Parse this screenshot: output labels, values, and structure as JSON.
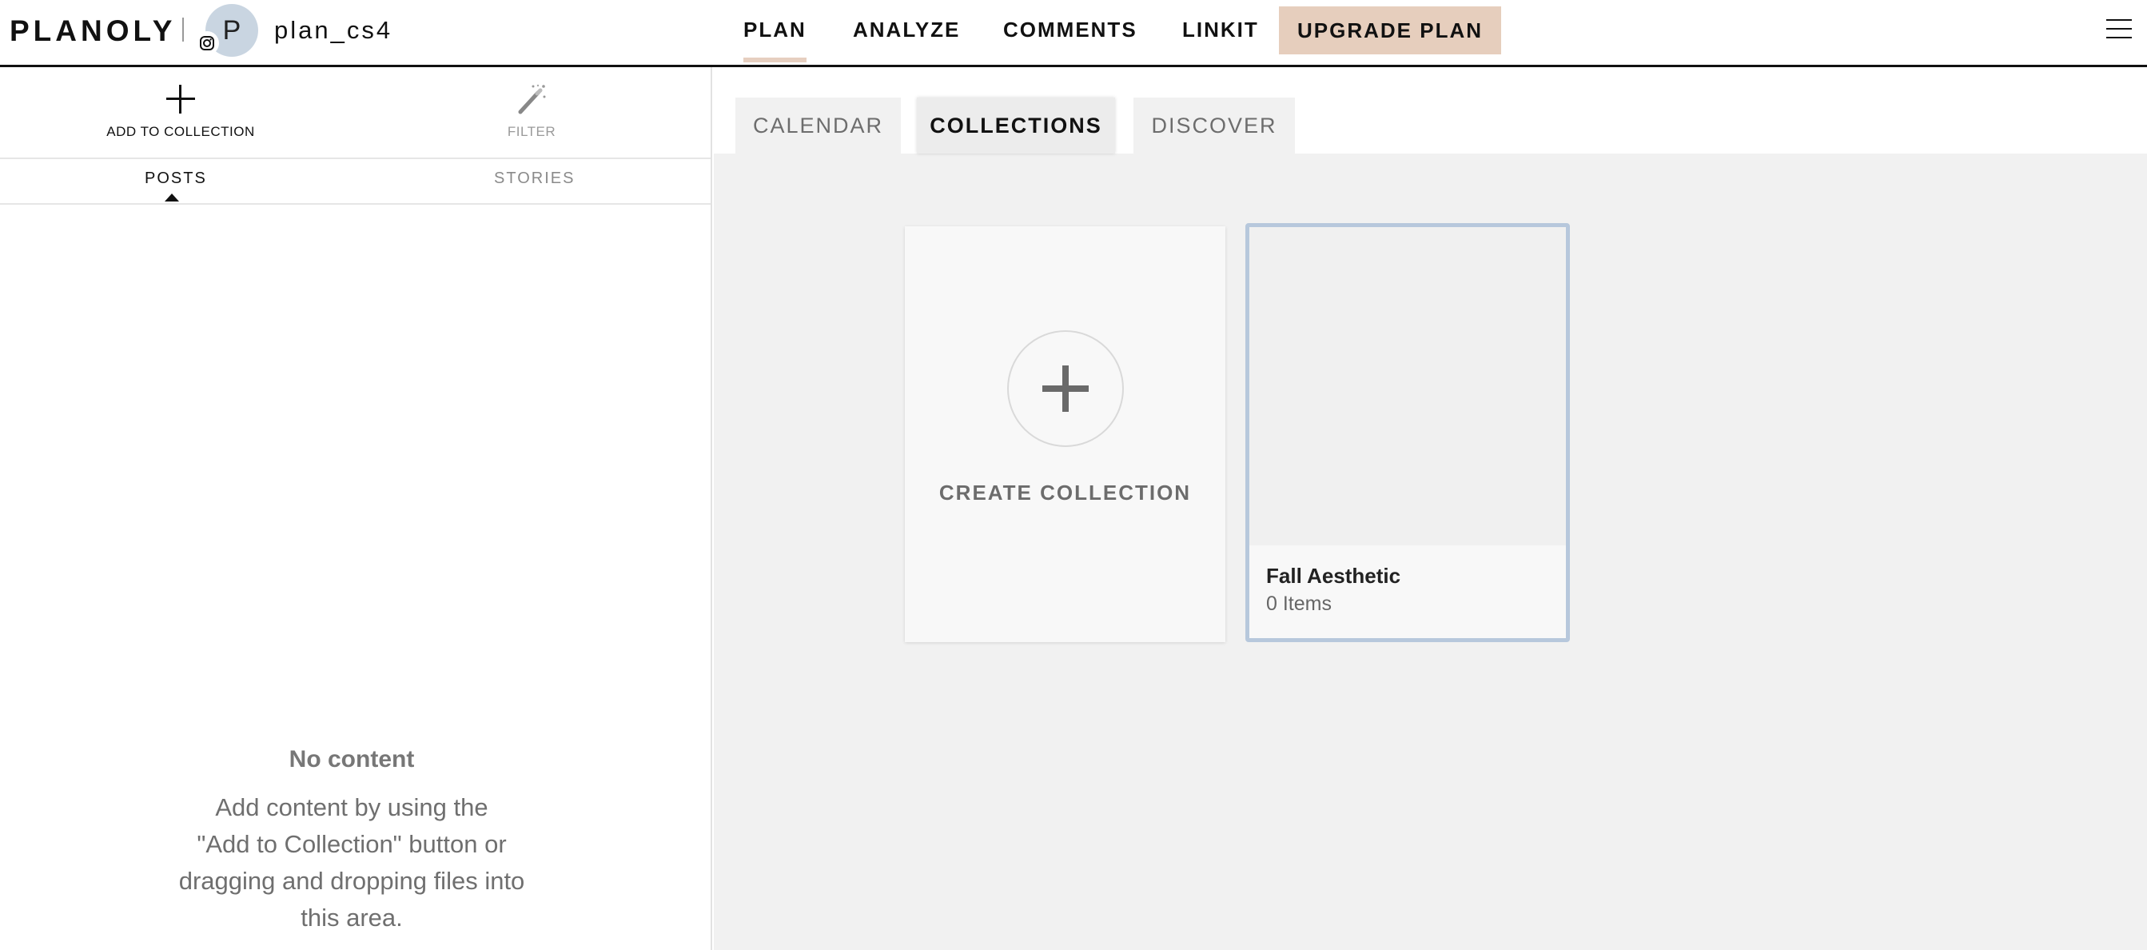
{
  "header": {
    "logo": "PLANOLY",
    "avatar_initial": "P",
    "account_name": "plan_cs4",
    "nav": [
      {
        "label": "PLAN",
        "active": true
      },
      {
        "label": "ANALYZE",
        "active": false
      },
      {
        "label": "COMMENTS",
        "active": false
      },
      {
        "label": "LINKIT",
        "active": false
      }
    ],
    "upgrade_label": "UPGRADE PLAN",
    "icons": {
      "account_badge": "instagram-icon",
      "menu": "hamburger-menu-icon"
    }
  },
  "left_panel": {
    "tools": {
      "add_label": "ADD TO COLLECTION",
      "add_icon": "plus-icon",
      "filter_label": "FILTER",
      "filter_icon": "magic-wand-icon"
    },
    "subtabs": {
      "posts": "POSTS",
      "stories": "STORIES",
      "active": "POSTS"
    },
    "empty_state": {
      "title": "No content",
      "line1": "Add content by using the",
      "line2": "\"Add to Collection\" button or",
      "line3": "dragging and dropping files into",
      "line4": "this area."
    }
  },
  "right_panel": {
    "tabs": [
      {
        "label": "CALENDAR",
        "active": false
      },
      {
        "label": "COLLECTIONS",
        "active": true
      },
      {
        "label": "DISCOVER",
        "active": false
      }
    ],
    "create_card": {
      "label": "CREATE COLLECTION",
      "icon": "plus-circle-icon"
    },
    "collections": [
      {
        "name": "Fall Aesthetic",
        "count": "0 Items"
      }
    ]
  },
  "colors": {
    "accent_upgrade": "#e6cebd",
    "active_nav_underline": "#e6cfc0",
    "selected_card_border": "#b7c8dc",
    "content_background": "#f1f1f1",
    "avatar": "#c9d5e1"
  }
}
